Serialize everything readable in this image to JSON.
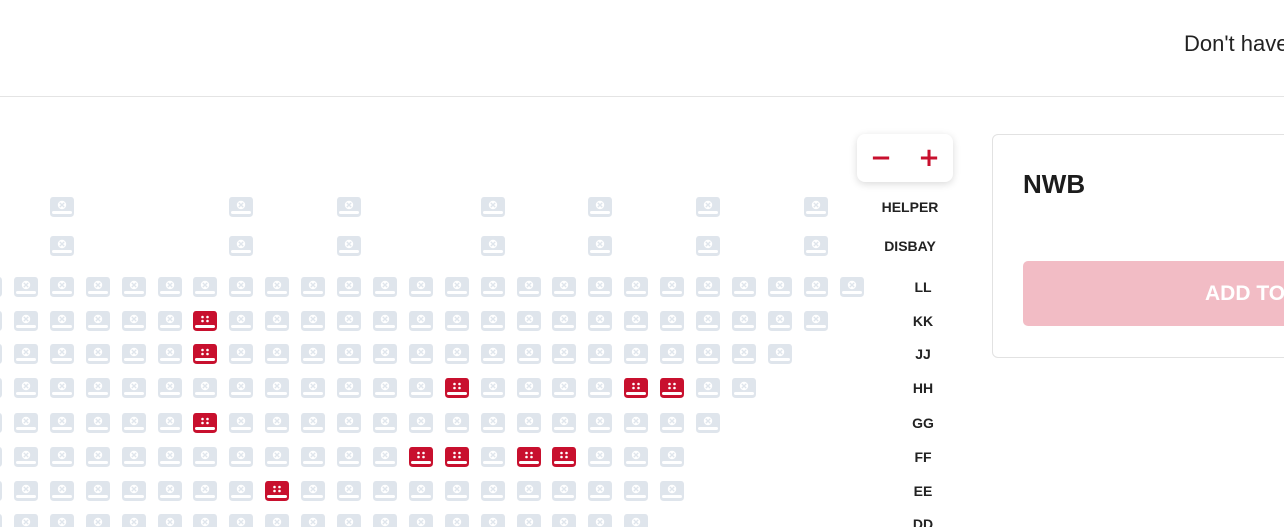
{
  "header": {
    "text": "Don't have"
  },
  "zoom": {
    "minus": "−",
    "plus": "+"
  },
  "panel": {
    "title": "NWB",
    "add_label": "ADD TO"
  },
  "seat_status_colors": {
    "unavailable": "#dfe5ec",
    "available": "#c8102e"
  },
  "rows": [
    {
      "label": "HELPER",
      "unavailable_cols": [
        2,
        7,
        10,
        14,
        17,
        20,
        23
      ]
    },
    {
      "label": "DISBAY",
      "unavailable_cols": [
        2,
        7,
        10,
        14,
        17,
        20,
        23
      ]
    },
    {
      "label": "LL",
      "unavailable_cols": [
        0,
        1,
        2,
        3,
        4,
        5,
        6,
        7,
        8,
        9,
        10,
        11,
        12,
        13,
        14,
        15,
        16,
        17,
        18,
        19,
        20,
        21,
        22,
        23,
        24
      ]
    },
    {
      "label": "KK",
      "unavailable_cols": [
        0,
        1,
        2,
        3,
        4,
        5,
        7,
        8,
        9,
        10,
        11,
        12,
        13,
        14,
        15,
        16,
        17,
        18,
        19,
        20,
        21,
        22,
        23
      ],
      "available_cols": [
        6
      ]
    },
    {
      "label": "JJ",
      "unavailable_cols": [
        0,
        1,
        2,
        3,
        4,
        5,
        7,
        8,
        9,
        10,
        11,
        12,
        13,
        14,
        15,
        16,
        17,
        18,
        19,
        20,
        21,
        22
      ],
      "available_cols": [
        6
      ]
    },
    {
      "label": "HH",
      "unavailable_cols": [
        0,
        1,
        2,
        3,
        4,
        5,
        6,
        7,
        8,
        9,
        10,
        11,
        12,
        14,
        15,
        16,
        17,
        20,
        21
      ],
      "available_cols": [
        13,
        18,
        19
      ]
    },
    {
      "label": "GG",
      "unavailable_cols": [
        0,
        1,
        2,
        3,
        4,
        5,
        7,
        8,
        9,
        10,
        11,
        12,
        13,
        14,
        15,
        16,
        17,
        18,
        19,
        20
      ],
      "available_cols": [
        6
      ]
    },
    {
      "label": "FF",
      "unavailable_cols": [
        0,
        1,
        2,
        3,
        4,
        5,
        6,
        7,
        8,
        9,
        10,
        11,
        14,
        17,
        18,
        19
      ],
      "available_cols": [
        12,
        13,
        15,
        16
      ]
    },
    {
      "label": "EE",
      "unavailable_cols": [
        0,
        1,
        2,
        3,
        4,
        5,
        6,
        7,
        9,
        10,
        11,
        12,
        13,
        14,
        15,
        16,
        17,
        18,
        19
      ],
      "available_cols": [
        8
      ]
    },
    {
      "label": "DD",
      "unavailable_cols": [
        0,
        1,
        2,
        3,
        4,
        5,
        6,
        7,
        8,
        9,
        10,
        11,
        12,
        13,
        14,
        15,
        16,
        17,
        18
      ]
    }
  ]
}
